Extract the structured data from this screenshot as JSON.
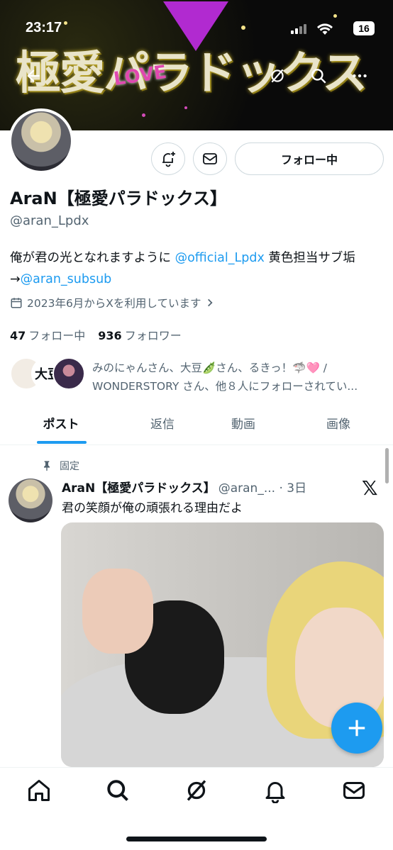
{
  "status_bar": {
    "time": "23:17",
    "battery": "16"
  },
  "banner": {
    "title": "極愛パラドックス",
    "love": "LOVE"
  },
  "profile": {
    "name": "AraN【極愛パラドックス】",
    "handle": "@aran_Lpdx",
    "follow_button": "フォロー中",
    "bio_text_1": "俺が君の光となれますように",
    "bio_link_1": "@official_Lpdx",
    "bio_text_2": "黄色担当サブ垢→",
    "bio_link_2": "@aran_subsub",
    "joined": "2023年6月からXを利用しています",
    "following_count": "47",
    "following_label": "フォロー中",
    "followers_count": "936",
    "followers_label": "フォロワー",
    "followed_by_line1": "みのにゃんさん、大豆🫛さん、るきっ！🦈🩷 /",
    "followed_by_line2": "WONDERSTORY さん、他８人にフォローされてい...",
    "follower_avatar_text": "大豆"
  },
  "tabs": [
    {
      "label": "ポスト",
      "active": true
    },
    {
      "label": "返信",
      "active": false
    },
    {
      "label": "動画",
      "active": false
    },
    {
      "label": "画像",
      "active": false
    }
  ],
  "post": {
    "pinned_label": "固定",
    "author": "AraN【極愛パラドックス】",
    "handle_time": "@aran_... · 3日",
    "text": "君の笑顔が俺の頑張れる理由だよ"
  },
  "colors": {
    "accent": "#1d9bf0",
    "text": "#0f1419",
    "muted": "#536471"
  },
  "icons": {
    "top": [
      "back-arrow-icon",
      "grok-icon",
      "search-icon",
      "more-icon"
    ],
    "profile": [
      "notification-add-icon",
      "message-icon",
      "calendar-icon",
      "chevron-right-icon",
      "pin-icon",
      "x-logo-icon",
      "compose-plus-icon"
    ],
    "nav": [
      "home-icon",
      "search-icon",
      "grok-icon",
      "notifications-icon",
      "messages-icon"
    ]
  }
}
